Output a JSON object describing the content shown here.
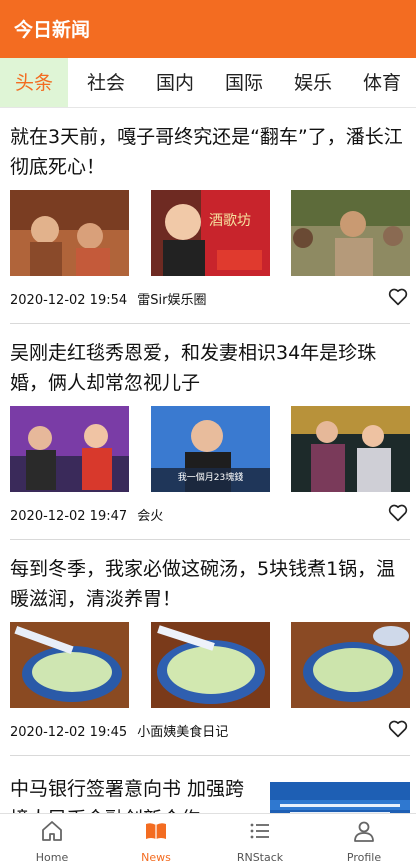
{
  "appbar": {
    "title": "今日新闻"
  },
  "tabs": [
    {
      "label": "头条",
      "active": true
    },
    {
      "label": "社会",
      "active": false
    },
    {
      "label": "国内",
      "active": false
    },
    {
      "label": "国际",
      "active": false
    },
    {
      "label": "娱乐",
      "active": false
    },
    {
      "label": "体育",
      "active": false
    }
  ],
  "articles": [
    {
      "title": "就在3天前，嘎子哥终究还是“翻车”了，潘长江彻底死心！",
      "time": "2020-12-02 19:54",
      "source": "雷Sir娱乐圈",
      "thumb_labels": [
        "",
        "酒歌坊",
        ""
      ]
    },
    {
      "title": "吴刚走红毯秀恩爱，和发妻相识34年是珍珠婚，俩人却常忽视儿子",
      "time": "2020-12-02 19:47",
      "source": "会火",
      "thumb_labels": [
        "",
        "我一個月23塊錢",
        ""
      ]
    },
    {
      "title": "每到冬季，我家必做这碗汤，5块钱煮1锅，温暖滋润，清淡养胃！",
      "time": "2020-12-02 19:45",
      "source": "小面姨美食日记",
      "thumb_labels": [
        "",
        "",
        ""
      ]
    },
    {
      "title": "中马银行签署意向书 加强跨境人民币金融创新合作",
      "time": "",
      "source": "",
      "thumb_labels": []
    }
  ],
  "bottom_nav": [
    {
      "label": "Home",
      "icon": "home-icon",
      "active": false
    },
    {
      "label": "News",
      "icon": "newspaper-icon",
      "active": true
    },
    {
      "label": "RNStack",
      "icon": "list-icon",
      "active": false
    },
    {
      "label": "Profile",
      "icon": "person-icon",
      "active": false
    }
  ],
  "colors": {
    "accent": "#f36c21",
    "active_tab_bg": "#dff5d6"
  }
}
